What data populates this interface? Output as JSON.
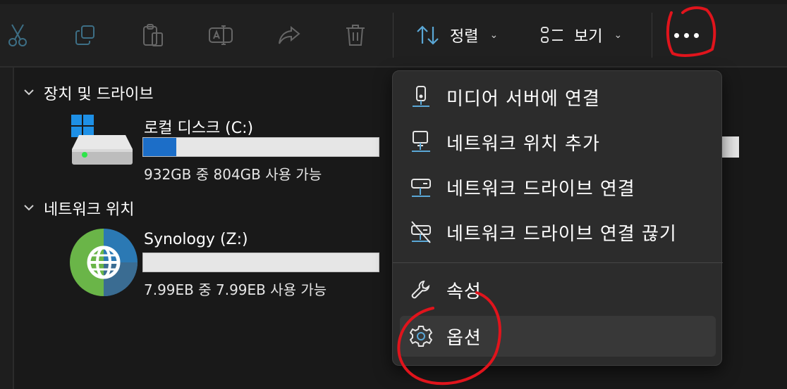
{
  "toolbar": {
    "sort_label": "정렬",
    "view_label": "보기",
    "chevron": "⌄"
  },
  "groups": {
    "devices": {
      "label": "장치 및 드라이브"
    },
    "network": {
      "label": "네트워크 위치"
    }
  },
  "drives": [
    {
      "name": "로컬 디스크 (C:)",
      "free_text": "932GB 중 804GB 사용 가능",
      "used_fraction": 0.14,
      "icon": "hard-drive-windows-icon"
    },
    {
      "name": "Synology (Z:)",
      "free_text": "7.99EB 중 7.99EB 사용 가능",
      "used_fraction": 0.0,
      "icon": "network-globe-drive-icon"
    }
  ],
  "menu": {
    "items": [
      {
        "label": "미디어 서버에 연결",
        "icon": "media-server-icon"
      },
      {
        "label": "네트워크 위치 추가",
        "icon": "add-network-location-icon"
      },
      {
        "label": "네트워크 드라이브 연결",
        "icon": "map-network-drive-icon"
      },
      {
        "label": "네트워크 드라이브 연결 끊기",
        "icon": "disconnect-network-drive-icon"
      },
      {
        "label": "속성",
        "icon": "wrench-icon"
      },
      {
        "label": "옵션",
        "icon": "gear-icon"
      }
    ]
  },
  "colors": {
    "background": "#191919",
    "toolbar": "#202020",
    "menu_bg": "#2c2c2c",
    "accent_blue": "#1c6ec8",
    "annotation_red": "#e0141c"
  }
}
